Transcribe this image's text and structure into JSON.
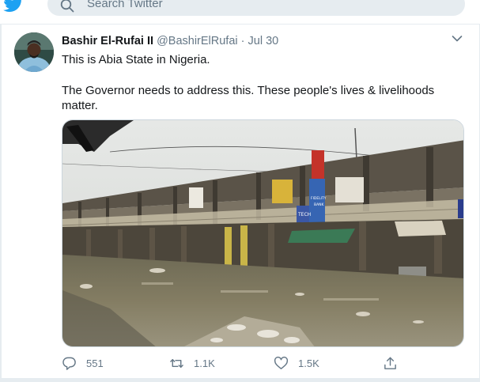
{
  "header": {
    "search_placeholder": "Search Twitter"
  },
  "tweet": {
    "author_name": "Bashir El-Rufai II",
    "author_handle": "@BashirElRufai",
    "separator": "·",
    "date": "Jul 30",
    "text_line1": "This is Abia State in Nigeria.",
    "text_line2": "The Governor needs to address this. These people's lives & livelihoods matter.",
    "image_signs": [
      "TECH",
      "FIDELITY",
      "BANK"
    ]
  },
  "actions": {
    "replies": "551",
    "retweets": "1.1K",
    "likes": "1.5K"
  },
  "colors": {
    "brand": "#1da1f2",
    "text": "#14171a",
    "secondary": "#657786",
    "border": "#e6ecf0"
  },
  "icons": [
    "twitter-bird-icon",
    "search-icon",
    "chevron-down-icon",
    "reply-icon",
    "retweet-icon",
    "heart-icon",
    "share-icon"
  ]
}
